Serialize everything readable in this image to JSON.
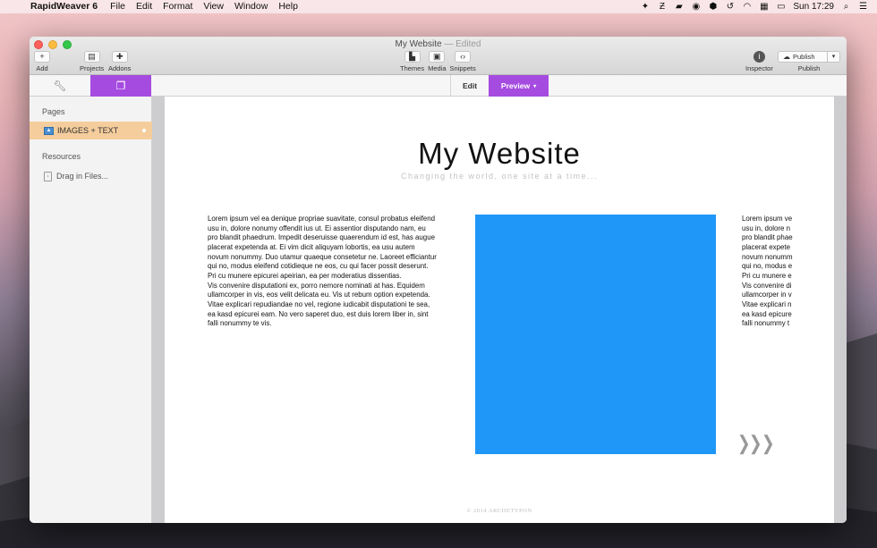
{
  "menubar": {
    "app_name": "RapidWeaver 6",
    "items": [
      "File",
      "Edit",
      "Format",
      "View",
      "Window",
      "Help"
    ],
    "clock": "Sun 17:29"
  },
  "window": {
    "title": "My Website",
    "title_status": "— Edited"
  },
  "toolbar": {
    "add_label": "Add",
    "projects_label": "Projects",
    "addons_label": "Addons",
    "themes_label": "Themes",
    "media_label": "Media",
    "snippets_label": "Snippets",
    "inspector_label": "Inspector",
    "publish_button": "Publish",
    "publish_label": "Publish"
  },
  "modes": {
    "edit": "Edit",
    "preview": "Preview"
  },
  "sidebar": {
    "pages_header": "Pages",
    "pages": [
      {
        "label": "IMAGES + TEXT"
      }
    ],
    "resources_header": "Resources",
    "resources_hint": "Drag in Files..."
  },
  "site": {
    "title": "My Website",
    "tagline": "Changing the world, one site at a time...",
    "body_text": [
      "Lorem ipsum vel ea denique propriae suavitate, consul probatus eleifend",
      "usu in, dolore nonumy offendit ius ut. Ei assentior disputando nam, eu",
      "pro blandit phaedrum. Impedit deseruisse quaerendum id est, has augue",
      "placerat expetenda at. Ei vim dicit aliquyam lobortis, ea usu autem",
      "novum nonummy. Duo utamur quaeque consetetur ne. Laoreet efficiantur",
      "qui no, modus eleifend cotidieque ne eos, cu qui facer possit deserunt.",
      "Pri cu munere epicurei apeirian, ea per moderatius dissentias.",
      "Vis convenire disputationi ex, porro nemore nominati at has. Equidem",
      "ullamcorper in vis, eos velit delicata eu. Vis ut rebum option expetenda.",
      "Vitae explicari repudiandae no vel, regione iudicabit disputationi te sea,",
      "ea kasd epicurei eam. No vero saperet duo, est duis lorem liber in, sint",
      "falli nonummy te vis."
    ],
    "body_text_partial": [
      "Lorem ipsum ve",
      "usu in, dolore n",
      "pro blandit phae",
      "placerat expete",
      "novum nonumm",
      "qui no, modus e",
      "Pri cu munere e",
      "Vis convenire di",
      "ullamcorper in v",
      "Vitae explicari n",
      "ea kasd epicure",
      "falli nonummy t"
    ],
    "footer": "© 2014 ARCHETYPON",
    "hero_color": "#1f97f8"
  },
  "colors": {
    "accent": "#a64be0",
    "selected_page": "#f5cd9c"
  }
}
